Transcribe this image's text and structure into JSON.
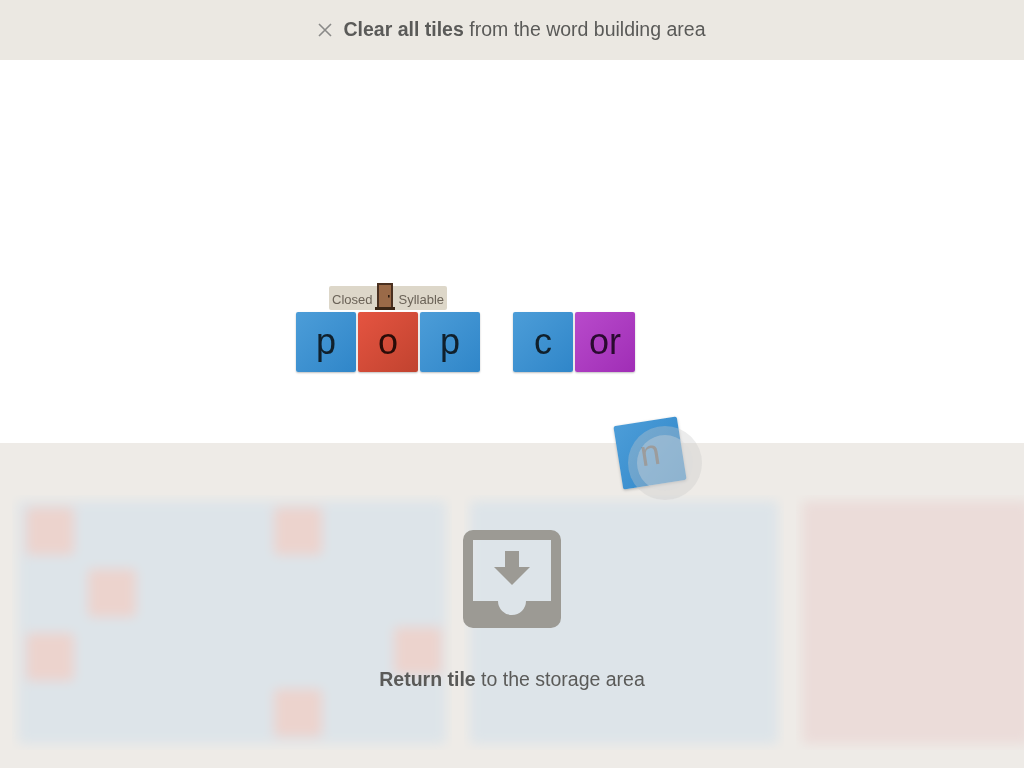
{
  "clear_bar": {
    "text": "**Clear all tiles** from the word building area"
  },
  "word_area": {
    "words": [
      {
        "syllable": {
          "before": "Closed",
          "after": "Syllable"
        },
        "tiles": [
          {
            "letter": "p",
            "kind": "consonant"
          },
          {
            "letter": "o",
            "kind": "vowel"
          },
          {
            "letter": "p",
            "kind": "consonant"
          }
        ]
      },
      {
        "tiles": [
          {
            "letter": "c",
            "kind": "consonant"
          },
          {
            "letter": "or",
            "kind": "r-controlled"
          }
        ]
      }
    ]
  },
  "dragged_tile": {
    "letter": "n",
    "kind": "consonant"
  },
  "drop_zone": {
    "text": "**Return tile** to the storage area"
  }
}
